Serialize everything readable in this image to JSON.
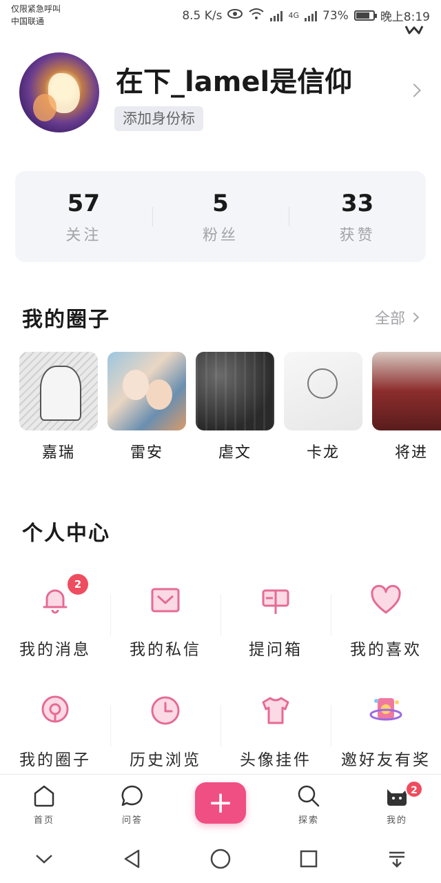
{
  "status_bar": {
    "carrier_line1": "仅限紧急呼叫",
    "carrier_line2": "中国联通",
    "speed": "8.5 K/s",
    "network": "4G",
    "battery": "73%",
    "battery_level": 0.73,
    "time": "晚上8:19"
  },
  "profile": {
    "username": "在下_lamel是信仰",
    "identity_tag": "添加身份标"
  },
  "stats": [
    {
      "value": "57",
      "label": "关注"
    },
    {
      "value": "5",
      "label": "粉丝"
    },
    {
      "value": "33",
      "label": "获赞"
    }
  ],
  "circles_section": {
    "title": "我的圈子",
    "see_all": "全部",
    "items": [
      {
        "name": "嘉瑞"
      },
      {
        "name": "雷安"
      },
      {
        "name": "虐文"
      },
      {
        "name": "卡龙"
      },
      {
        "name": "将进"
      }
    ]
  },
  "personal_center": {
    "title": "个人中心",
    "items": [
      {
        "label": "我的消息",
        "icon": "bell-icon",
        "badge": "2"
      },
      {
        "label": "我的私信",
        "icon": "envelope-icon"
      },
      {
        "label": "提问箱",
        "icon": "mailbox-icon"
      },
      {
        "label": "我的喜欢",
        "icon": "heart-icon"
      },
      {
        "label": "我的圈子",
        "icon": "circle-pin-icon"
      },
      {
        "label": "历史浏览",
        "icon": "clock-icon"
      },
      {
        "label": "头像挂件",
        "icon": "tshirt-icon"
      },
      {
        "label": "邀好友有奖",
        "icon": "gift-planet-icon"
      }
    ]
  },
  "bottom_nav": {
    "items": [
      {
        "label": "首页",
        "icon": "home-icon"
      },
      {
        "label": "问答",
        "icon": "chat-bubble-icon"
      },
      {
        "label": "+",
        "icon": "add-icon"
      },
      {
        "label": "探索",
        "icon": "search-icon"
      },
      {
        "label": "我的",
        "icon": "cat-icon",
        "badge": "2"
      }
    ]
  },
  "colors": {
    "accent": "#f04f83",
    "icon_pink": "#e56b95",
    "badge_red": "#ee4d5f",
    "card_bg": "#f4f5f8"
  }
}
